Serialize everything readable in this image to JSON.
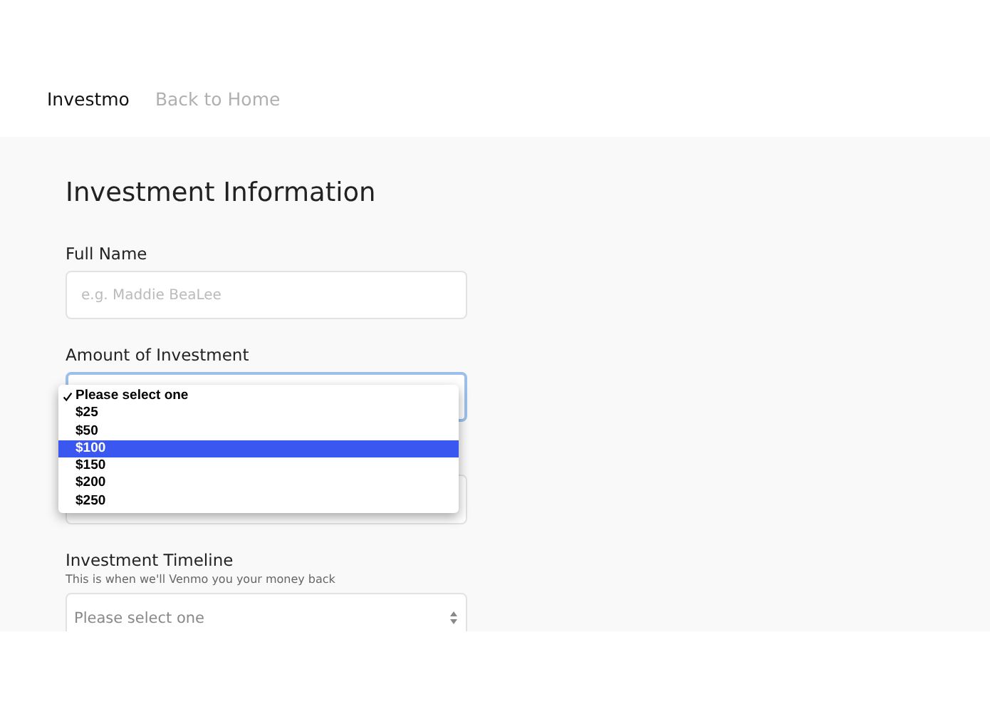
{
  "nav": {
    "brand": "Investmo",
    "link": "Back to Home"
  },
  "form": {
    "title": "Investment Information",
    "fields": [
      {
        "kind": "text",
        "label": "Full Name",
        "placeholder": "e.g. Maddie BeaLee"
      },
      {
        "kind": "select",
        "label": "Amount of Investment",
        "focused": true,
        "dropdown": {
          "options": [
            {
              "label": "Please select one",
              "selected": true,
              "highlighted": false
            },
            {
              "label": "$25",
              "selected": false,
              "highlighted": false
            },
            {
              "label": "$50",
              "selected": false,
              "highlighted": false
            },
            {
              "label": "$100",
              "selected": false,
              "highlighted": true
            },
            {
              "label": "$150",
              "selected": false,
              "highlighted": false
            },
            {
              "label": "$200",
              "selected": false,
              "highlighted": false
            },
            {
              "label": "$250",
              "selected": false,
              "highlighted": false
            }
          ]
        }
      },
      {
        "kind": "select",
        "focused": false
      },
      {
        "kind": "select",
        "label": "Investment Timeline",
        "hint": "This is when we'll Venmo you your money back",
        "value": "Please select one",
        "focused": false
      }
    ]
  }
}
